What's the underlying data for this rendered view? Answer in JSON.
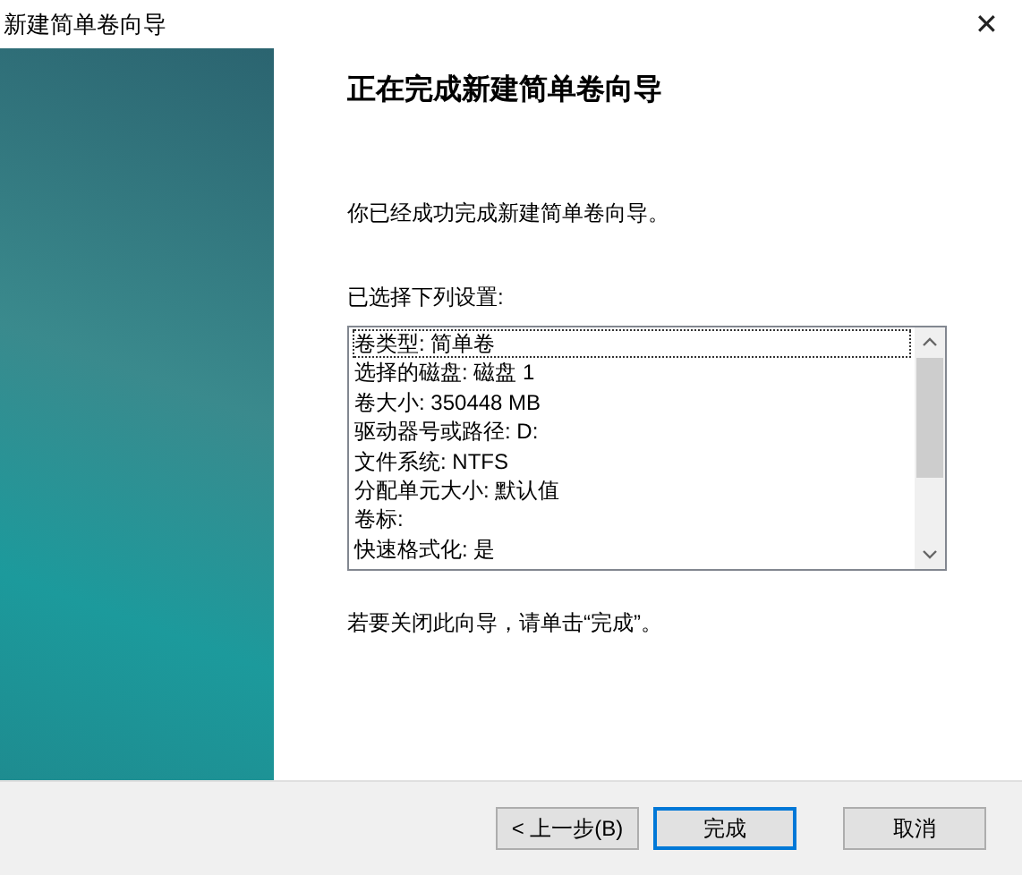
{
  "window": {
    "title": "新建简单卷向导",
    "close": "✕"
  },
  "heading": "正在完成新建简单卷向导",
  "intro": "你已经成功完成新建简单卷向导。",
  "settings_label": "已选择下列设置:",
  "settings": [
    {
      "text": "卷类型: 简单卷",
      "selected": true
    },
    {
      "text": "选择的磁盘: 磁盘 1",
      "selected": false
    },
    {
      "text": "卷大小: 350448 MB",
      "selected": false
    },
    {
      "text": "驱动器号或路径: D:",
      "selected": false
    },
    {
      "text": "文件系统: NTFS",
      "selected": false
    },
    {
      "text": "分配单元大小: 默认值",
      "selected": false
    },
    {
      "text": "卷标:",
      "selected": false
    },
    {
      "text": "快速格式化: 是",
      "selected": false
    }
  ],
  "closing_hint": "若要关闭此向导，请单击“完成”。",
  "buttons": [
    {
      "label": "< 上一步(B)",
      "default": false
    },
    {
      "label": "完成",
      "default": true
    },
    {
      "label": "取消",
      "default": false
    }
  ]
}
